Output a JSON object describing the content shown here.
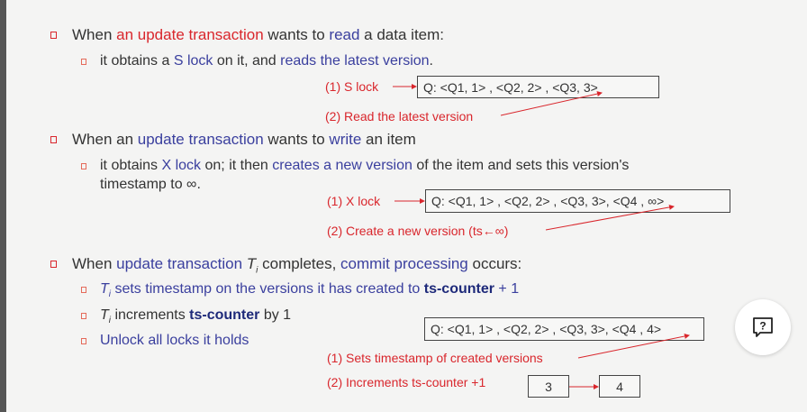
{
  "section1": {
    "line": {
      "t1": "When ",
      "t2": "an update transaction",
      "t3": " wants to ",
      "t4": "read",
      "t5": " a data item:"
    },
    "sub": {
      "t1": "it obtains a ",
      "t2": "S lock",
      "t3": " on it, and ",
      "t4": "reads the latest version",
      "t5": "."
    },
    "step1": "(1) S lock",
    "step2": "(2) Read  the latest version",
    "box": "Q: <Q1, 1> ,  <Q2, 2> ,  <Q3,  3>"
  },
  "section2": {
    "line": {
      "t1": "When an ",
      "t2": "update transaction",
      "t3": " wants to ",
      "t4": "write",
      "t5": " an item"
    },
    "sub": {
      "t1": "it obtains ",
      "t2": "X lock",
      "t3": " on; it then ",
      "t4": "creates a new version",
      "t5": " of the item and sets this version's",
      "t6": "timestamp to ∞."
    },
    "step1": "(1) X lock",
    "step2": "(2) Create a new version (ts←∞)",
    "box": "Q: <Q1, 1> ,  <Q2, 2> ,  <Q3,  3>, <Q4 , ∞>"
  },
  "section3": {
    "line": {
      "t1": "When ",
      "t2": "update transaction",
      "t3": "T",
      "t3sub": "i",
      "t4": " completes, ",
      "t5": "commit processing",
      "t6": " occurs:"
    },
    "sub1": {
      "t1": "T",
      "t1sub": "i",
      "t2": " sets timestamp on the versions it has created to ",
      "t3": "ts-counter",
      "t4": " + 1"
    },
    "sub2": {
      "t1": "T",
      "t1sub": "i",
      "t2": " increments ",
      "t3": "ts-counter",
      "t4": " by 1"
    },
    "sub3": "Unlock all locks it holds",
    "box": "Q: <Q1, 1> ,  <Q2, 2> ,  <Q3, 3>, <Q4 , 4>",
    "step1": "(1) Sets timestamp of created versions",
    "step2": "(2) Increments ts-counter +1",
    "counter_before": "3",
    "counter_after": "4"
  },
  "help_button": {
    "label": "?",
    "icon": "question-bubble-icon"
  },
  "colors": {
    "accent_red": "#d9262c",
    "accent_blue": "#3a3f9e",
    "emphasis": "#1e2a7a"
  }
}
